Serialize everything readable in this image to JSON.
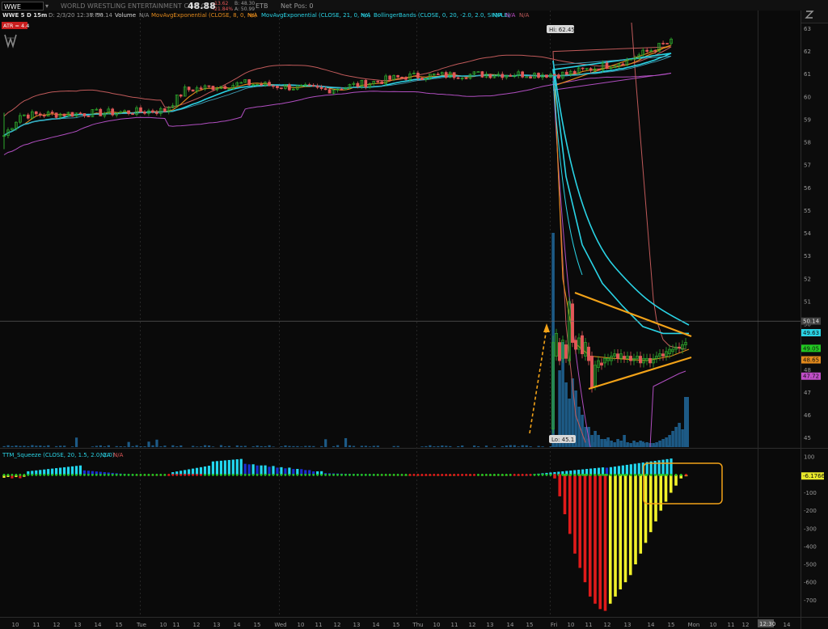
{
  "toolbar": {
    "symbol": "WWE",
    "company": "WORLD WRESTLING ENTERTAINMENT COM CL A",
    "last": "48.88",
    "change": "-13.62",
    "change_pct": "-21.84%",
    "bid": "B: 48.30",
    "ask": "A: 50.99",
    "exchange": "ETB",
    "net_pos": "Net Pos: 0"
  },
  "price_legend": {
    "chart_label": "WWE 5 D 15m",
    "date": "D: 2/3/20 12:30 PM",
    "y_readout": "Y: 50.14",
    "volume": "Volume",
    "na": "N/A",
    "ema8": "MovAvgExponential (CLOSE, 8, 0, no)",
    "ema21": "MovAvgExponential (CLOSE, 21, 0, no)",
    "bb": "BollingerBands (CLOSE, 0, 20, -2.0, 2.0, SIMPLE)",
    "atr": "ATR = 4.4"
  },
  "squeeze_legend": {
    "label": "TTM_Squeeze (CLOSE, 20, 1.5, 2.0, 1.0)",
    "na": "N/A"
  },
  "annotations": {
    "hi": "Hi: 62.45",
    "lo": "Lo: 45.1",
    "cursor_price": "50.14",
    "cursor_time": "12:30"
  },
  "price_badges": [
    {
      "label": "49.63",
      "value": 49.63,
      "color": "#2ad4e6"
    },
    {
      "label": "49.05",
      "value": 49.05,
      "color": "#22c922"
    },
    {
      "label": "48.65",
      "value": 48.65,
      "color": "#e38a1c"
    },
    {
      "label": "47.72",
      "value": 47.72,
      "color": "#c04ec8"
    }
  ],
  "squeeze_badge": {
    "label": "-6.1766",
    "value": -6.1766
  },
  "colors": {
    "ema8": "#e38a1c",
    "ema21": "#2ad4e6",
    "bb_upper": "#c05a5a",
    "bb_lower": "#b04ec0",
    "bb_mid": "#3fa0b8",
    "candle_up": "#2eaa2e",
    "candle_down": "#e25858",
    "volume": "#1d5a86",
    "trendline": "#f2a218"
  },
  "chart_data": [
    {
      "type": "candlestick",
      "symbol": "WWE",
      "timeframe": "15m",
      "ylim": [
        44.6,
        63.3
      ],
      "y_ticks": [
        45,
        46,
        47,
        48,
        49,
        50,
        51,
        52,
        53,
        54,
        55,
        56,
        57,
        58,
        59,
        60,
        61,
        62,
        63
      ],
      "x_ticks": [
        "10",
        "11",
        "12",
        "13",
        "14",
        "15",
        "Tue",
        "10",
        "11",
        "12",
        "13",
        "14",
        "15",
        "Wed",
        "10",
        "11",
        "12",
        "13",
        "14",
        "15",
        "Thu",
        "10",
        "11",
        "12",
        "13",
        "14",
        "15",
        "Fri",
        "10",
        "11",
        "12",
        "13",
        "14",
        "15",
        "Mon",
        "10",
        "11",
        "12",
        "13",
        "14"
      ],
      "series": [
        {
          "name": "MovAvgExponential (CLOSE, 8, 0, no)",
          "color": "#e38a1c"
        },
        {
          "name": "MovAvgExponential (CLOSE, 21, 0, no)",
          "color": "#2ad4e6"
        },
        {
          "name": "BollingerBands (CLOSE, 0, 20, -2.0, 2.0, SIMPLE)"
        },
        {
          "name": "Volume"
        }
      ],
      "close_path": [
        59.1,
        59.3,
        59.2,
        59.3,
        59.2,
        59.3,
        59.4,
        59.8,
        60.1,
        60.4,
        60.6,
        60.7,
        60.6,
        60.5,
        60.3,
        60.2,
        60.3,
        60.4,
        60.5,
        60.6,
        60.8,
        60.9,
        61.0,
        61.0,
        60.9,
        60.8,
        60.8,
        60.9,
        60.9,
        61.2,
        61.0,
        60.8,
        60.9,
        61.0,
        61.1,
        61.3,
        61.5,
        61.8,
        62.1,
        62.3,
        62.4,
        45.5,
        49.5,
        48.0,
        47.5,
        48.2,
        48.5,
        48.4,
        48.6,
        48.6,
        48.7,
        48.8,
        48.9,
        49.05
      ],
      "session_high": 62.45,
      "session_low": 45.1
    },
    {
      "type": "bar",
      "name": "TTM_Squeeze (CLOSE, 20, 1.5, 2.0, 1.0)",
      "ylim": [
        -780,
        110
      ],
      "y_ticks": [
        100,
        -100,
        -200,
        -300,
        -400,
        -500,
        -600,
        -700
      ],
      "last_value": -6.1766
    }
  ]
}
